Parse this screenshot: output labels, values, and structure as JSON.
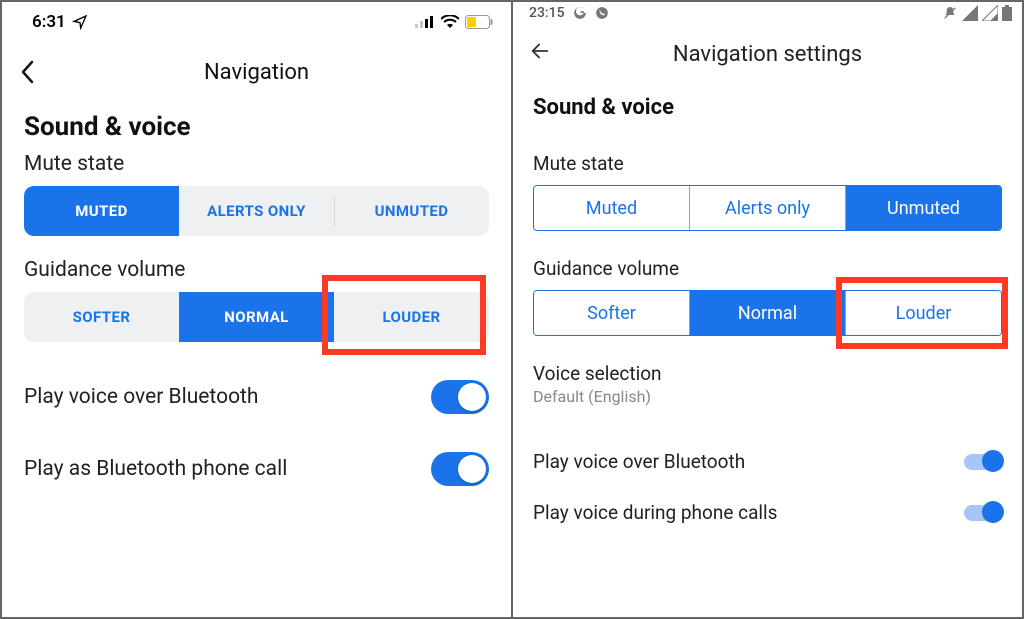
{
  "left": {
    "statusbar": {
      "time": "6:31"
    },
    "nav": {
      "title": "Navigation"
    },
    "h1": "Sound & voice",
    "mute": {
      "label": "Mute state",
      "options": [
        "MUTED",
        "ALERTS ONLY",
        "UNMUTED"
      ],
      "selected_index": 0
    },
    "guidance": {
      "label": "Guidance volume",
      "options": [
        "SOFTER",
        "NORMAL",
        "LOUDER"
      ],
      "selected_index": 1,
      "highlighted_index": 2
    },
    "rows": {
      "bluetooth": {
        "label": "Play voice over Bluetooth",
        "value": true
      },
      "bt_phone": {
        "label": "Play as Bluetooth phone call",
        "value": true
      }
    }
  },
  "right": {
    "statusbar": {
      "time": "23:15"
    },
    "nav": {
      "title": "Navigation settings"
    },
    "h1": "Sound & voice",
    "mute": {
      "label": "Mute state",
      "options": [
        "Muted",
        "Alerts only",
        "Unmuted"
      ],
      "selected_index": 2
    },
    "guidance": {
      "label": "Guidance volume",
      "options": [
        "Softer",
        "Normal",
        "Louder"
      ],
      "selected_index": 1,
      "highlighted_index": 2
    },
    "voice_selection": {
      "title": "Voice selection",
      "subtitle": "Default (English)"
    },
    "rows": {
      "bluetooth": {
        "label": "Play voice over Bluetooth",
        "value": true
      },
      "during_calls": {
        "label": "Play voice during phone calls",
        "value": true
      }
    }
  },
  "colors": {
    "accent": "#1a73e8",
    "highlight": "#ff3a24"
  }
}
